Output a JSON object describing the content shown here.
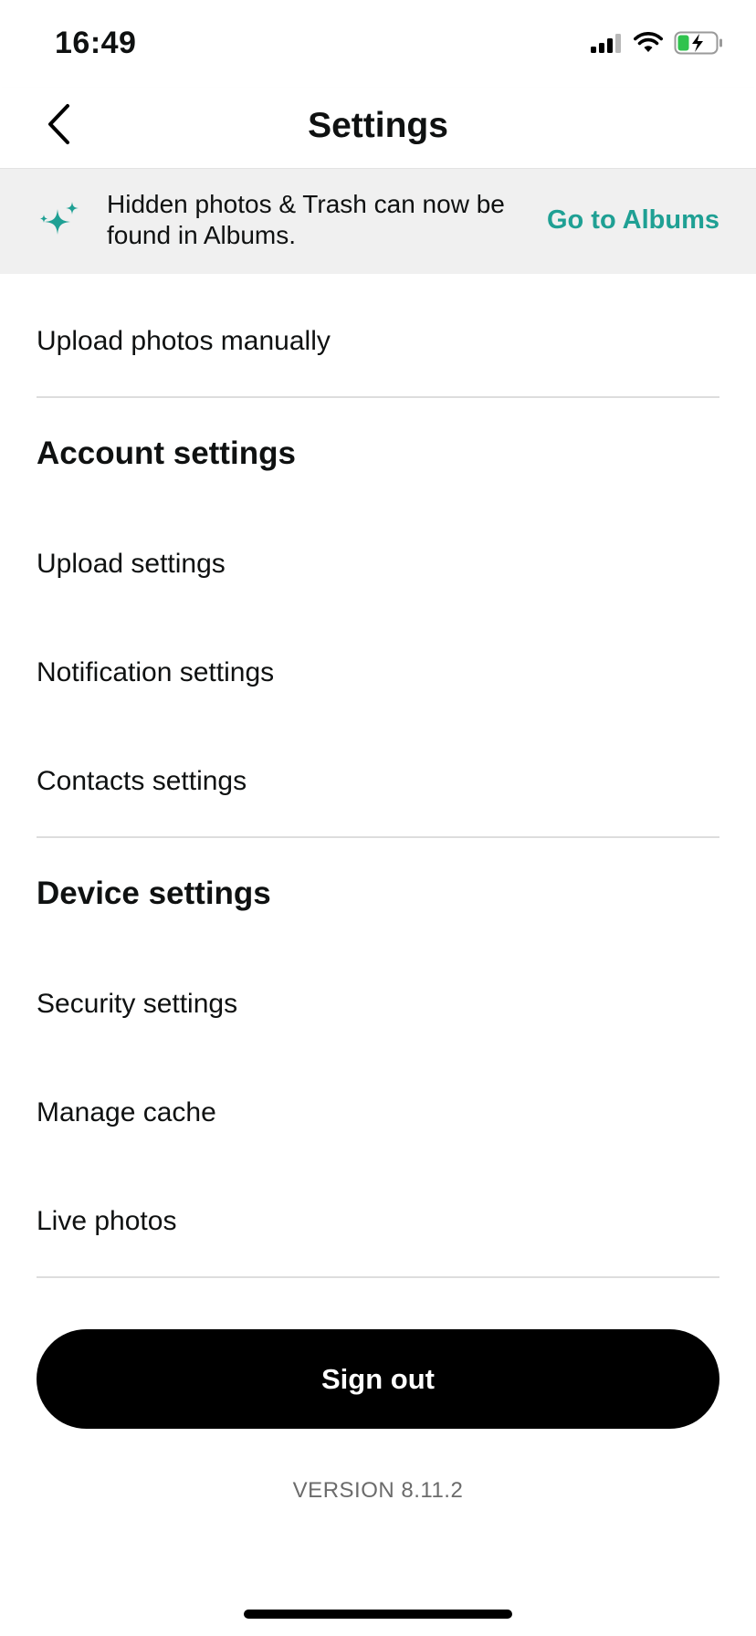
{
  "status_bar": {
    "time": "16:49"
  },
  "nav": {
    "title": "Settings",
    "back_icon": "chevron-left-icon"
  },
  "banner": {
    "icon": "sparkles-icon",
    "message": "Hidden photos & Trash can now be found in Albums.",
    "link_label": "Go to Albums",
    "accent_color": "#1fa094",
    "background_color": "#f0f0f0"
  },
  "items": {
    "upload_manually": "Upload photos manually",
    "account_heading": "Account settings",
    "upload_settings": "Upload settings",
    "notification_settings": "Notification settings",
    "contacts_settings": "Contacts settings",
    "device_heading": "Device settings",
    "security_settings": "Security settings",
    "manage_cache": "Manage cache",
    "live_photos": "Live photos"
  },
  "sign_out": {
    "label": "Sign out"
  },
  "footer": {
    "version": "VERSION 8.11.2"
  }
}
